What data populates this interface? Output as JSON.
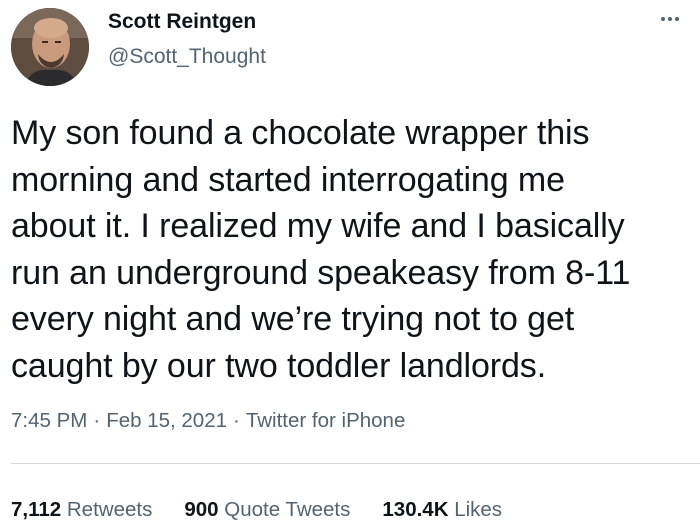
{
  "author": {
    "display_name": "Scott Reintgen",
    "handle": "@Scott_Thought",
    "avatar_icon": "person-avatar"
  },
  "menu_icon": "more-horizontal-icon",
  "tweet": {
    "lines": [
      "My son found a chocolate wrapper this",
      "morning and started interrogating me",
      "about it. I realized my wife and I basically",
      "run an underground speakeasy from 8-11",
      "every night and we’re trying not to get",
      "caught by our two toddler landlords."
    ]
  },
  "meta": {
    "time": "7:45 PM",
    "separator": "·",
    "date": "Feb 15, 2021",
    "source": "Twitter for iPhone"
  },
  "stats": {
    "retweets_count": "7,112",
    "retweets_label": "Retweets",
    "quotes_count": "900",
    "quotes_label": "Quote Tweets",
    "likes_count": "130.4K",
    "likes_label": "Likes"
  },
  "colors": {
    "text_primary": "#0f1419",
    "text_secondary": "#536471",
    "divider": "#cfd9de"
  }
}
